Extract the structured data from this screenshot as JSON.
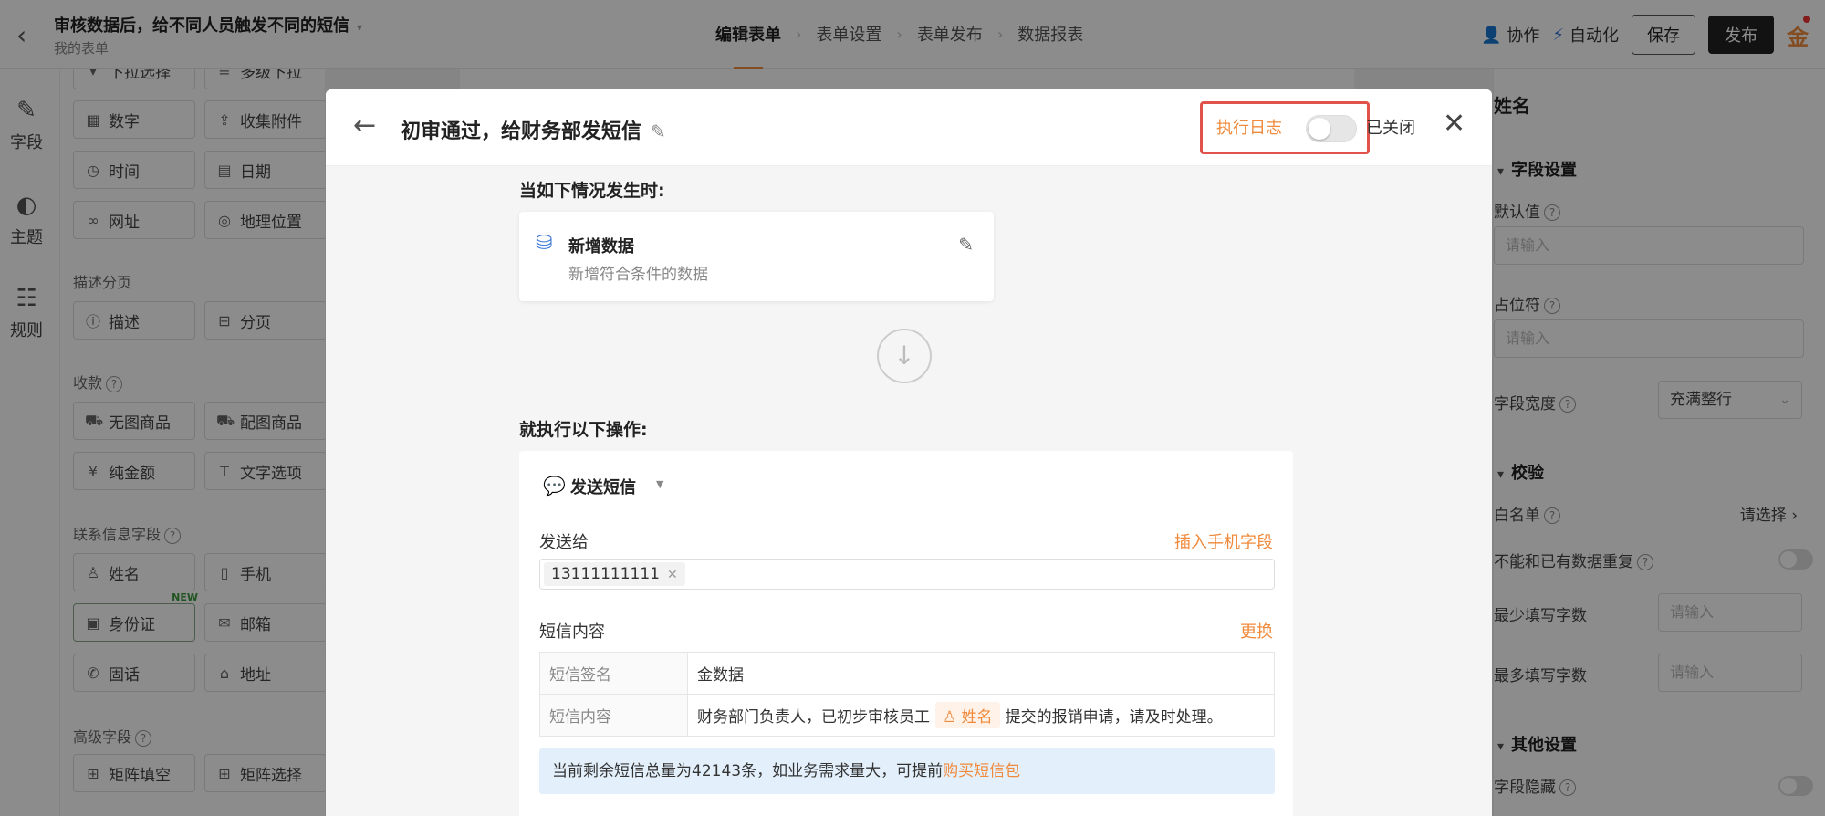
{
  "header": {
    "form_title": "审核数据后，给不同人员触发不同的短信",
    "form_subtitle": "我的表单",
    "steps": [
      "编辑表单",
      "表单设置",
      "表单发布",
      "数据报表"
    ],
    "collab_label": "协作",
    "automation_label": "自动化",
    "save_label": "保存",
    "publish_label": "发布",
    "brand_text": "金"
  },
  "rail": {
    "items": [
      {
        "label": "字段",
        "icon": "edit-icon"
      },
      {
        "label": "主题",
        "icon": "palette-icon"
      },
      {
        "label": "规则",
        "icon": "rules-icon"
      }
    ]
  },
  "palette": {
    "top_items": [
      "下拉选择",
      "多级下拉"
    ],
    "basic_items": [
      {
        "label": "数字",
        "icon": "number-icon"
      },
      {
        "label": "收集附件",
        "icon": "upload-icon"
      },
      {
        "label": "时间",
        "icon": "clock-icon"
      },
      {
        "label": "日期",
        "icon": "calendar-icon"
      },
      {
        "label": "网址",
        "icon": "link-icon"
      },
      {
        "label": "地理位置",
        "icon": "location-icon"
      }
    ],
    "section_desc": "描述分页",
    "desc_items": [
      {
        "label": "描述",
        "icon": "info-icon"
      },
      {
        "label": "分页",
        "icon": "pagebreak-icon"
      }
    ],
    "section_payment": "收款",
    "payment_items": [
      {
        "label": "无图商品",
        "icon": "cart-icon"
      },
      {
        "label": "配图商品",
        "icon": "cart-image-icon"
      },
      {
        "label": "纯金额",
        "icon": "yen-icon"
      },
      {
        "label": "文字选项",
        "icon": "text-option-icon"
      }
    ],
    "section_contact": "联系信息字段",
    "contact_items": [
      {
        "label": "姓名",
        "icon": "user-icon"
      },
      {
        "label": "手机",
        "icon": "phone-icon"
      },
      {
        "label": "身份证",
        "icon": "id-card-icon"
      },
      {
        "label": "邮箱",
        "icon": "mail-icon"
      },
      {
        "label": "固话",
        "icon": "telephone-icon"
      },
      {
        "label": "地址",
        "icon": "address-icon"
      }
    ],
    "new_tag": "NEW",
    "section_advanced": "高级字段",
    "advanced_items": [
      {
        "label": "矩阵填空",
        "icon": "matrix-icon"
      },
      {
        "label": "矩阵选择",
        "icon": "matrix-select-icon"
      }
    ]
  },
  "props": {
    "title": "姓名",
    "section_field": "字段设置",
    "default_label": "默认值",
    "default_placeholder": "请输入",
    "placeholder_label": "占位符",
    "placeholder_placeholder": "请输入",
    "width_label": "字段宽度",
    "width_value": "充满整行",
    "section_validate": "校验",
    "whitelist_label": "白名单",
    "whitelist_value": "请选择",
    "unique_label": "不能和已有数据重复",
    "min_label": "最少填写字数",
    "min_placeholder": "请输入",
    "max_label": "最多填写字数",
    "max_placeholder": "请输入",
    "section_other": "其他设置",
    "hide_label": "字段隐藏"
  },
  "modal": {
    "title": "初审通过，给财务部发短信",
    "log_label": "执行日志",
    "log_state": "已关闭",
    "trigger_heading": "当如下情况发生时:",
    "trigger_name": "新增数据",
    "trigger_desc": "新增符合条件的数据",
    "action_heading": "就执行以下操作:",
    "action_name": "发送短信",
    "sendto_label": "发送给",
    "insert_phone_label": "插入手机字段",
    "phone_tag": "13111111111",
    "content_label": "短信内容",
    "replace_label": "更换",
    "sms_rows": {
      "sig_key": "短信签名",
      "sig_val": "金数据",
      "content_key": "短信内容",
      "content_pre": "财务部门负责人，已初步审核员工",
      "content_field": "姓名",
      "content_post": "提交的报销申请，请及时处理。"
    },
    "notice_text": "当前剩余短信总量为42143条，如业务需求量大，可提前",
    "notice_link": "购买短信包"
  }
}
